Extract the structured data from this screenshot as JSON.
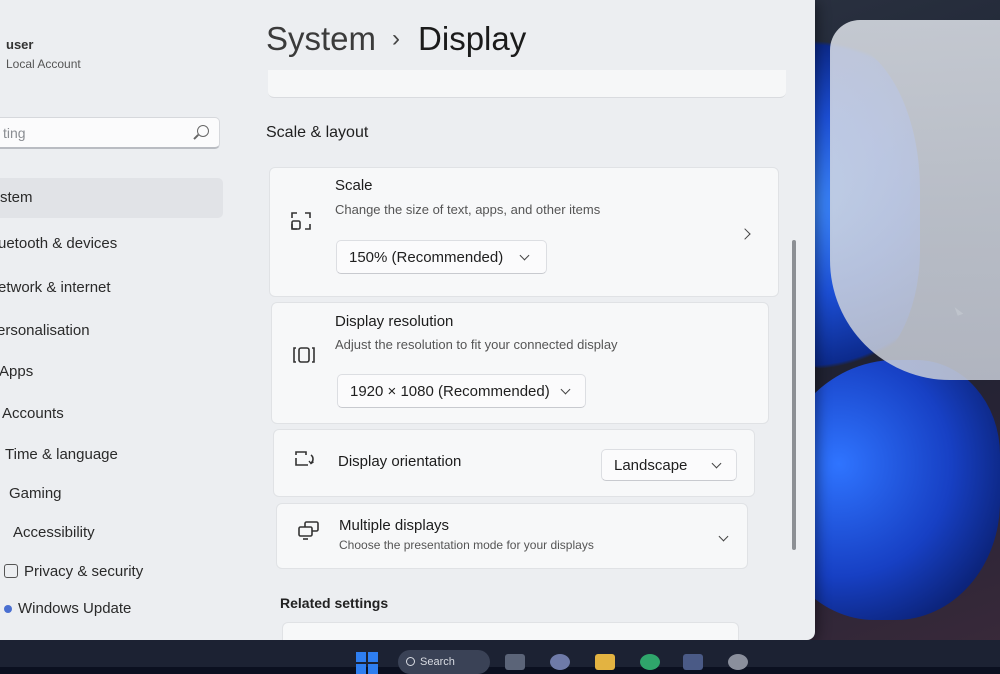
{
  "user": {
    "name": "user",
    "account_type": "Local Account"
  },
  "search": {
    "placeholder": "ting"
  },
  "sidebar": {
    "items": [
      {
        "label": "stem",
        "active": true
      },
      {
        "label": "uetooth & devices"
      },
      {
        "label": "etwork & internet"
      },
      {
        "label": "ersonalisation"
      },
      {
        "label": "Apps"
      },
      {
        "label": "Accounts"
      },
      {
        "label": "Time & language"
      },
      {
        "label": "Gaming"
      },
      {
        "label": "Accessibility"
      },
      {
        "label": "Privacy & security"
      },
      {
        "label": "Windows Update"
      }
    ]
  },
  "breadcrumb": {
    "parent": "System",
    "separator": "›",
    "current": "Display"
  },
  "section": {
    "title": "Scale & layout"
  },
  "cards": {
    "scale": {
      "title": "Scale",
      "description": "Change the size of text, apps, and other items",
      "value": "150% (Recommended)"
    },
    "resolution": {
      "title": "Display resolution",
      "description": "Adjust the resolution to fit your connected display",
      "value": "1920 × 1080 (Recommended)"
    },
    "orientation": {
      "title": "Display orientation",
      "value": "Landscape"
    },
    "multiple": {
      "title": "Multiple displays",
      "description": "Choose the presentation mode for your displays"
    }
  },
  "related": {
    "title": "Related settings"
  },
  "taskbar": {
    "search_label": "Search"
  },
  "colors": {
    "accent": "#2e7ef0",
    "window_bg": "#eceef1",
    "card_bg": "#f7f8f9"
  }
}
